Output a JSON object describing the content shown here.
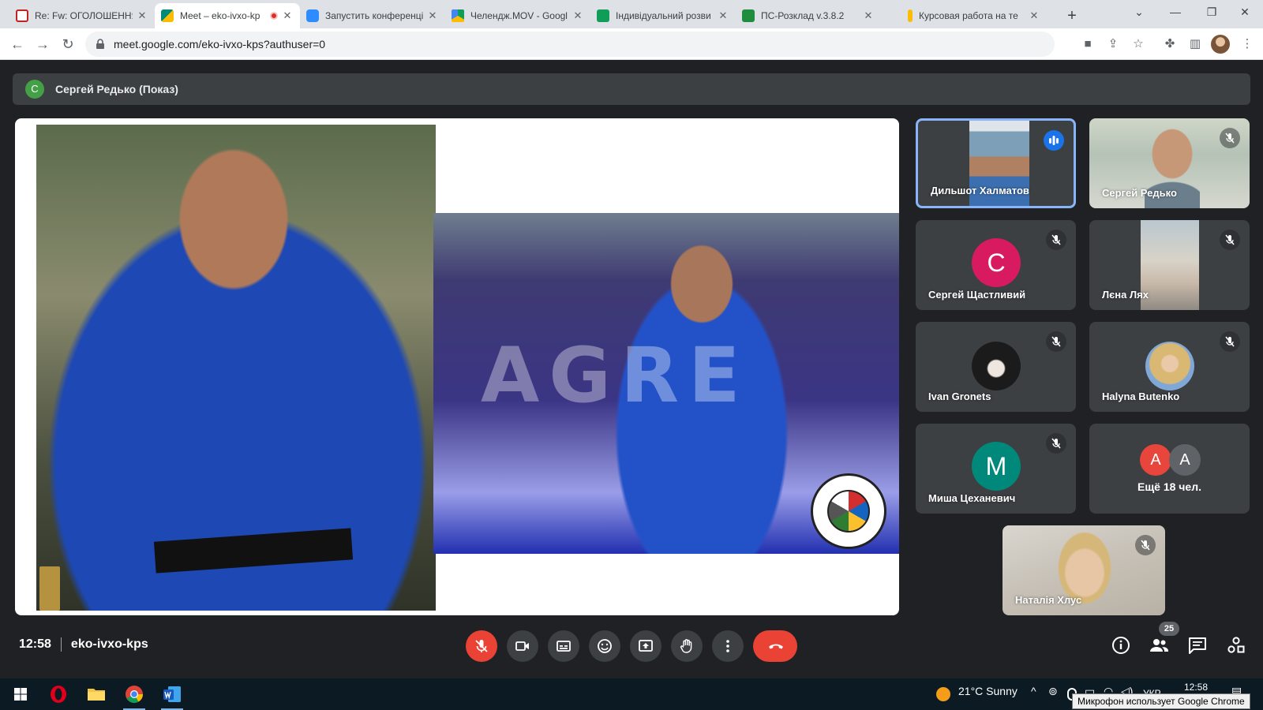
{
  "browser": {
    "tabs": [
      {
        "title": "Re: Fw: ОГОЛОШЕННЯ",
        "favicon": "gmail-icon",
        "color": "#c5221f"
      },
      {
        "title": "Meet – eko-ivxo-kp",
        "favicon": "meet-icon",
        "color": "#00897b"
      },
      {
        "title": "Запустить конференці",
        "favicon": "zoom-icon",
        "color": "#2d8cff"
      },
      {
        "title": "Челендж.MOV - Googl",
        "favicon": "drive-icon",
        "color": "#fbbc04"
      },
      {
        "title": "Індивідуальний розви",
        "favicon": "classroom-icon",
        "color": "#0f9d58"
      },
      {
        "title": "ПС-Розклад v.3.8.2",
        "favicon": "sheets-icon",
        "color": "#1e8e3e"
      },
      {
        "title": "Курсовая работа на те",
        "favicon": "doc-icon",
        "color": "#fbbc04"
      }
    ],
    "url": "meet.google.com/eko-ivxo-kps?authuser=0"
  },
  "presenter": {
    "avatar_letter": "С",
    "label": "Сергей Редько (Показ)"
  },
  "participants": [
    {
      "name": "Дильшот Халматов",
      "kind": "video",
      "speaking": true
    },
    {
      "name": "Сергей Редько",
      "kind": "video",
      "muted": true
    },
    {
      "name": "Сергей Щастливий",
      "kind": "letter",
      "letter": "С",
      "color": "#d81b60",
      "muted": true
    },
    {
      "name": "Лєна Лях",
      "kind": "video",
      "muted": true
    },
    {
      "name": "Ivan Gronets",
      "kind": "photo",
      "muted": true
    },
    {
      "name": "Halyna Butenko",
      "kind": "photo",
      "muted": true
    },
    {
      "name": "Миша Цеханевич",
      "kind": "letter",
      "letter": "М",
      "color": "#00897b",
      "muted": true
    },
    {
      "name": "Наталія Хлус",
      "kind": "video",
      "muted": true
    }
  ],
  "more": {
    "avatars": [
      {
        "letter": "А",
        "color": "#e8453c"
      },
      {
        "letter": "А",
        "color": "#5f6368"
      }
    ],
    "label": "Ещё 18 чел."
  },
  "meeting": {
    "time": "12:58",
    "code": "eko-ivxo-kps",
    "people_count": "25"
  },
  "taskbar": {
    "weather": "21°C  Sunny",
    "language": "УКР",
    "clock": "12:58",
    "tooltip": "Микрофон использует Google Chrome"
  }
}
